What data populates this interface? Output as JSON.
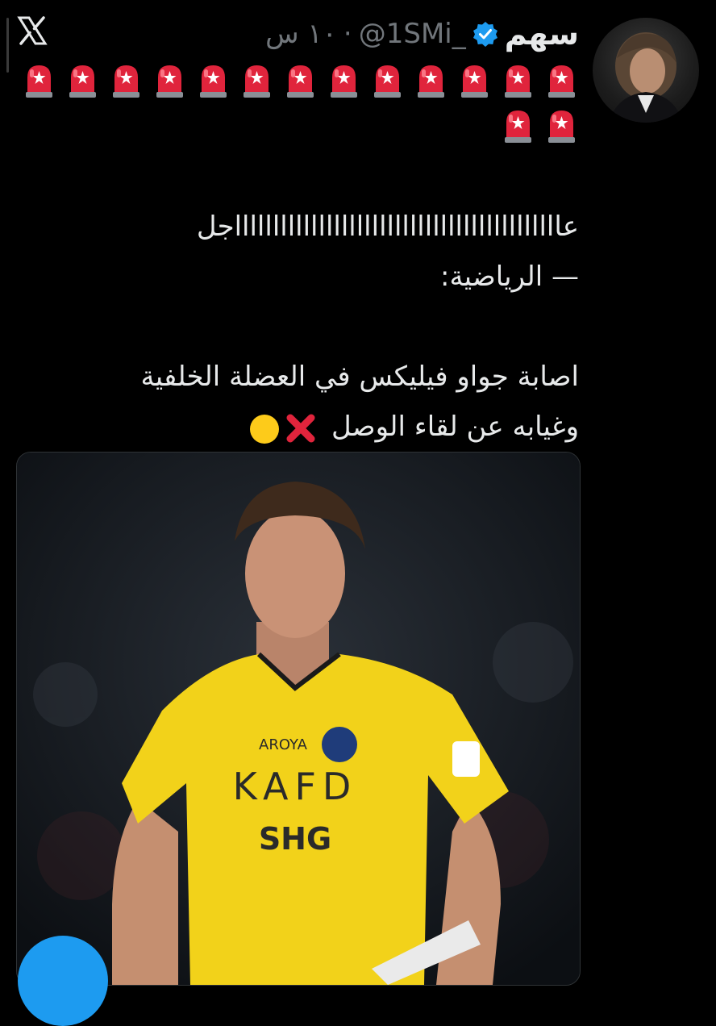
{
  "app": {
    "platform_logo_icon": "x-logo-icon"
  },
  "tweet": {
    "author": {
      "display_name": "سهم",
      "verified": true,
      "verified_color": "#1d9bf0",
      "handle": "@1SMi_",
      "time": "١٠ س",
      "avatar_icon": "profile-avatar"
    },
    "emoji_lines": [
      {
        "count": 13,
        "emoji": "🚨"
      },
      {
        "count": 2,
        "emoji": "🚨"
      }
    ],
    "text": {
      "line1": "عاااااااااااااااااااااااااااااااااااااااااااجل",
      "line2": "— الرياضية:",
      "line3": "اصابة جواو فيليكس في العضلة الخلفية",
      "line4": "وغيابه عن لقاء الوصل",
      "line4_icons": [
        "cross-mark-icon",
        "yellow-circle-icon"
      ]
    },
    "media": {
      "jersey": {
        "sponsor": "KAFD",
        "brand": "AROYA",
        "sponsor_small": "SHG",
        "jersey_color": "#f2d21a"
      }
    }
  },
  "colors": {
    "background": "#000000",
    "text": "#e7e9ea",
    "secondary": "#71767b",
    "siren_red": "#e0243c",
    "accent": "#1d9bf0"
  }
}
